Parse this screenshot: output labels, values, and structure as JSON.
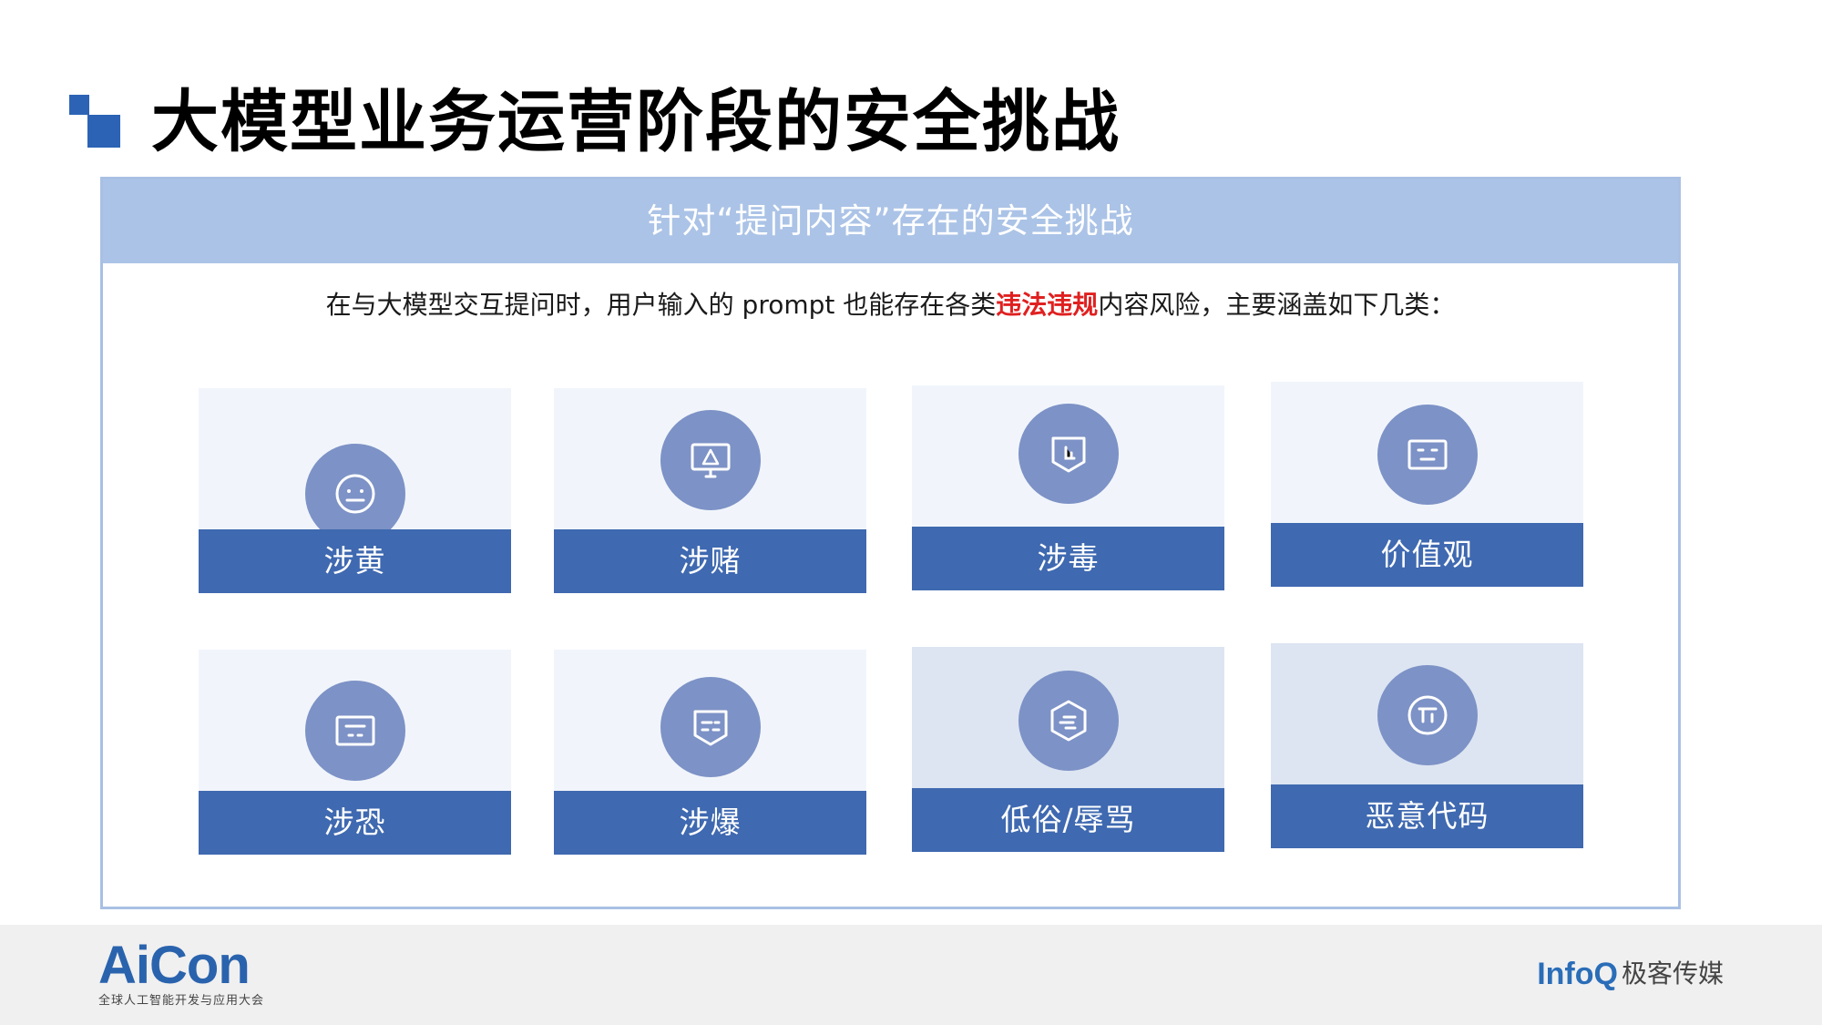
{
  "slide": {
    "title": "大模型业务运营阶段的安全挑战",
    "panel_header": "针对“提问内容”存在的安全挑战",
    "intro": {
      "before": "在与大模型交互提问时，用户输入的 prompt 也能存在各类",
      "highlight": "违法违规",
      "after": "内容风险，主要涵盖如下几类："
    }
  },
  "categories": [
    {
      "label": "涉黄",
      "icon": "face-icon"
    },
    {
      "label": "涉赌",
      "icon": "monitor-warning-icon"
    },
    {
      "label": "涉毒",
      "icon": "shield-icon"
    },
    {
      "label": "价值观",
      "icon": "screen-icon"
    },
    {
      "label": "涉恐",
      "icon": "screen-icon"
    },
    {
      "label": "涉爆",
      "icon": "shield-icon"
    },
    {
      "label": "低俗/辱骂",
      "icon": "hexagon-icon"
    },
    {
      "label": "恶意代码",
      "icon": "code-circle-icon"
    }
  ],
  "footer": {
    "aicon_logo": "AiCon",
    "aicon_tagline": "全球人工智能开发与应用大会",
    "infoq_logo": "InfoQ",
    "geek_media": "极客传媒"
  },
  "colors": {
    "accent": "#2c63b5",
    "header_band": "#abc3e6",
    "label_bar": "#3f69b0",
    "icon_circle": "#7d92c6",
    "highlight": "#e02020"
  }
}
